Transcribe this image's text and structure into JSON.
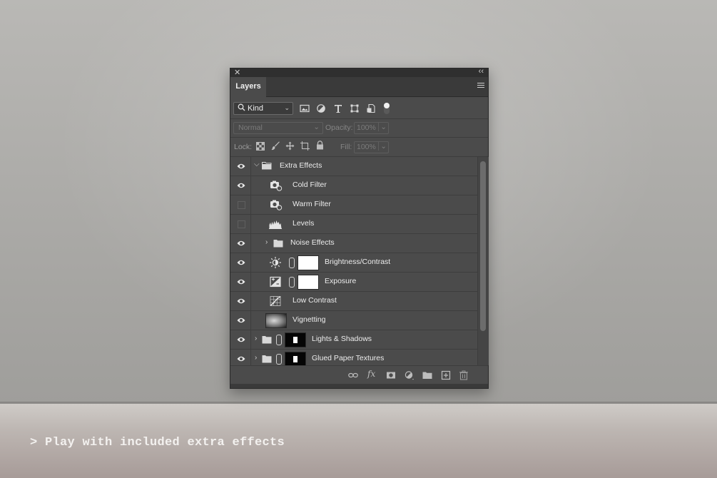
{
  "caption": "> Play with included extra effects",
  "panel": {
    "tab": "Layers",
    "filter": {
      "kind_label": "Kind"
    },
    "blend": {
      "mode": "Normal",
      "opacity_label": "Opacity:",
      "opacity_value": "100%"
    },
    "lock": {
      "label": "Lock:",
      "fill_label": "Fill:",
      "fill_value": "100%"
    }
  },
  "layers": [
    {
      "name": "Extra Effects",
      "visible": true,
      "type": "group-open"
    },
    {
      "name": "Cold Filter",
      "visible": true,
      "type": "photo-filter"
    },
    {
      "name": "Warm Filter",
      "visible": false,
      "type": "photo-filter"
    },
    {
      "name": "Levels",
      "visible": false,
      "type": "levels"
    },
    {
      "name": "Noise Effects",
      "visible": true,
      "type": "group-closed"
    },
    {
      "name": "Brightness/Contrast",
      "visible": true,
      "type": "brightness"
    },
    {
      "name": "Exposure",
      "visible": true,
      "type": "exposure"
    },
    {
      "name": "Low Contrast",
      "visible": true,
      "type": "curves"
    },
    {
      "name": "Vignetting",
      "visible": true,
      "type": "image"
    },
    {
      "name": "Lights & Shadows",
      "visible": true,
      "type": "group-masked"
    },
    {
      "name": "Glued Paper Textures",
      "visible": true,
      "type": "group-masked"
    }
  ]
}
